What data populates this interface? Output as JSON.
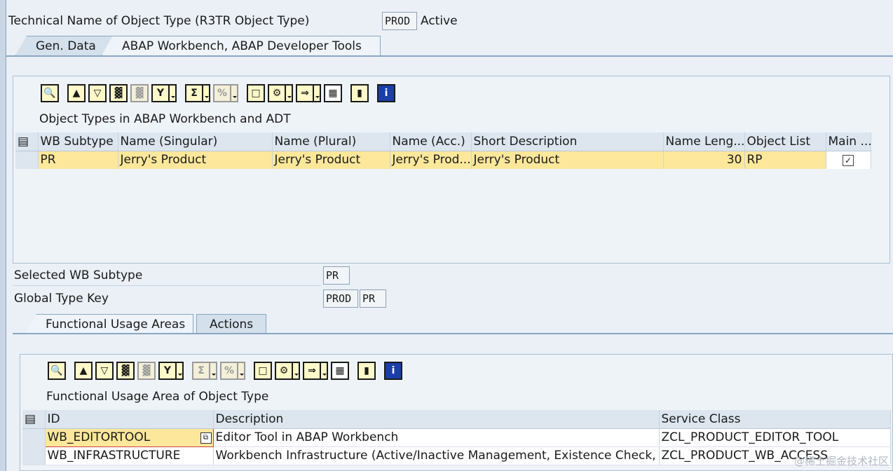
{
  "header": {
    "label": "Technical Name of Object Type (R3TR Object Type)",
    "value": "PROD",
    "status": "Active"
  },
  "outer_tabs": [
    {
      "label": "Gen. Data"
    },
    {
      "label": "ABAP Workbench, ABAP Developer Tools"
    }
  ],
  "top_grid": {
    "caption": "Object Types in ABAP Workbench and ADT",
    "columns": [
      "WB Subtype",
      "Name (Singular)",
      "Name (Plural)",
      "Name (Acc.)",
      "Short Description",
      "Name Leng...",
      "Object List",
      "Main ..."
    ],
    "rows": [
      {
        "wb_subtype": "PR",
        "name_singular": "Jerry's Product",
        "name_plural": "Jerry's Product",
        "name_acc": "Jerry's Prod...",
        "short_desc": "Jerry's Product",
        "name_length": "30",
        "object_list": "RP",
        "main": "✓"
      }
    ]
  },
  "selected_wb_subtype": {
    "label": "Selected WB Subtype",
    "value": "PR"
  },
  "global_type_key": {
    "label": "Global Type Key",
    "value1": "PROD",
    "value2": "PR"
  },
  "inner_tabs": [
    {
      "label": "Functional Usage Areas"
    },
    {
      "label": "Actions"
    }
  ],
  "bottom_grid": {
    "caption": "Functional Usage Area of Object Type",
    "columns": [
      "ID",
      "Description",
      "Service Class"
    ],
    "rows": [
      {
        "id": "WB_EDITORTOOL",
        "description": "Editor Tool in ABAP Workbench",
        "service_class": "ZCL_PRODUCT_EDITOR_TOOL"
      },
      {
        "id": "WB_INFRASTRUCTURE",
        "description": "Workbench Infrastructure (Active/Inactive Management, Existence Check,",
        "service_class": "ZCL_PRODUCT_WB_ACCESS"
      }
    ]
  },
  "toolbar_icons": [
    "details-icon",
    "print-icon",
    "filter-icon",
    "find-icon",
    "find-next-icon",
    "set-filter-icon",
    "sum-icon",
    "subtotal-icon",
    "print-preview-icon",
    "export-icon",
    "layout-icon",
    "grid-icon",
    "graphic-icon",
    "info-icon"
  ],
  "watermark": "@稀土掘金技术社区"
}
